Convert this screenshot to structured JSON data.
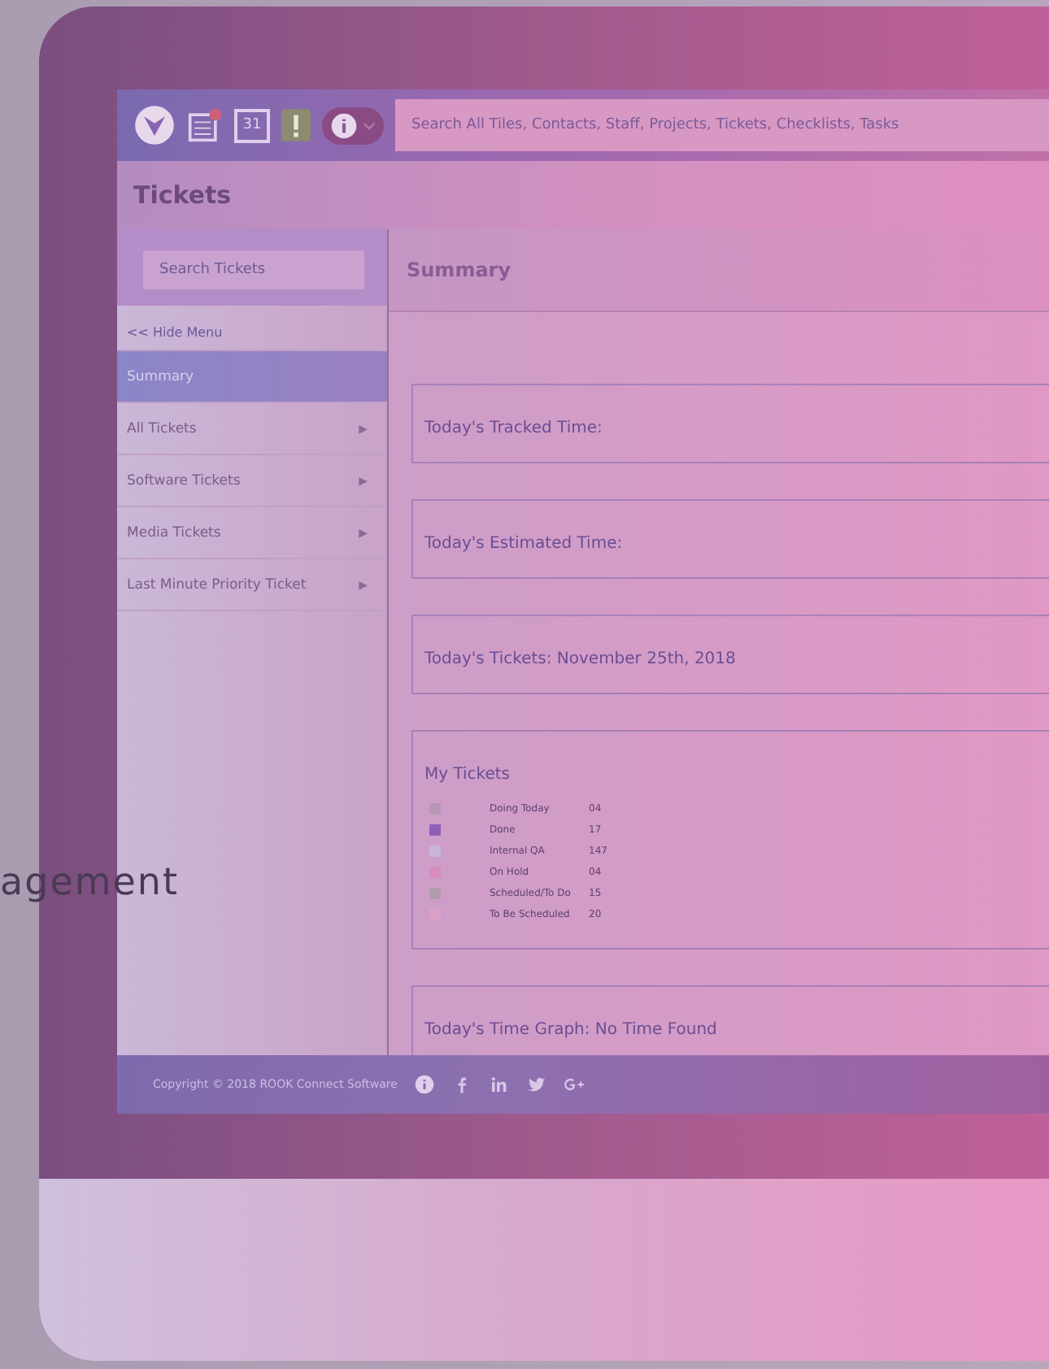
{
  "toolbar": {
    "calendar_day": "31",
    "search": {
      "placeholder": "Search All Tiles, Contacts, Staff, Projects, Tickets, Checklists, Tasks"
    }
  },
  "page_title": "Tickets",
  "sidebar": {
    "search": {
      "placeholder": "Search Tickets"
    },
    "hide_menu": "<< Hide Menu",
    "items": [
      {
        "label": "Summary",
        "selected": true
      },
      {
        "label": "All Tickets",
        "selected": false,
        "arrow": "▶"
      },
      {
        "label": "Software Tickets",
        "selected": false,
        "arrow": "▶"
      },
      {
        "label": "Media Tickets",
        "selected": false,
        "arrow": "▶"
      },
      {
        "label": "Last Minute Priority Ticket",
        "selected": false,
        "arrow": "▶"
      }
    ]
  },
  "main": {
    "heading": "Summary",
    "panels": [
      {
        "kind": "plain",
        "title": "Today's Tracked Time:"
      },
      {
        "kind": "plain",
        "title": "Today's Estimated Time:"
      },
      {
        "kind": "plain",
        "title": "Today's Tickets: November 25th, 2018"
      },
      {
        "kind": "legend",
        "title": "My Tickets",
        "items": [
          {
            "label": "Doing Today",
            "count": "04",
            "color": "#b898b4"
          },
          {
            "label": "Done",
            "count": "17",
            "color": "#9060b8"
          },
          {
            "label": "Internal QA",
            "count": "147",
            "color": "#c8b4d8"
          },
          {
            "label": "On Hold",
            "count": "04",
            "color": "#d88cc0"
          },
          {
            "label": "Scheduled/To Do",
            "count": "15",
            "color": "#b09cac"
          },
          {
            "label": "To Be Scheduled",
            "count": "20",
            "color": "#dca0c8"
          }
        ]
      },
      {
        "kind": "plain",
        "title": "Today's Time Graph: No Time Found"
      }
    ]
  },
  "footer": {
    "copyright": "Copyright © 2018 ROOK Connect Software"
  },
  "overlay_text": "agement"
}
